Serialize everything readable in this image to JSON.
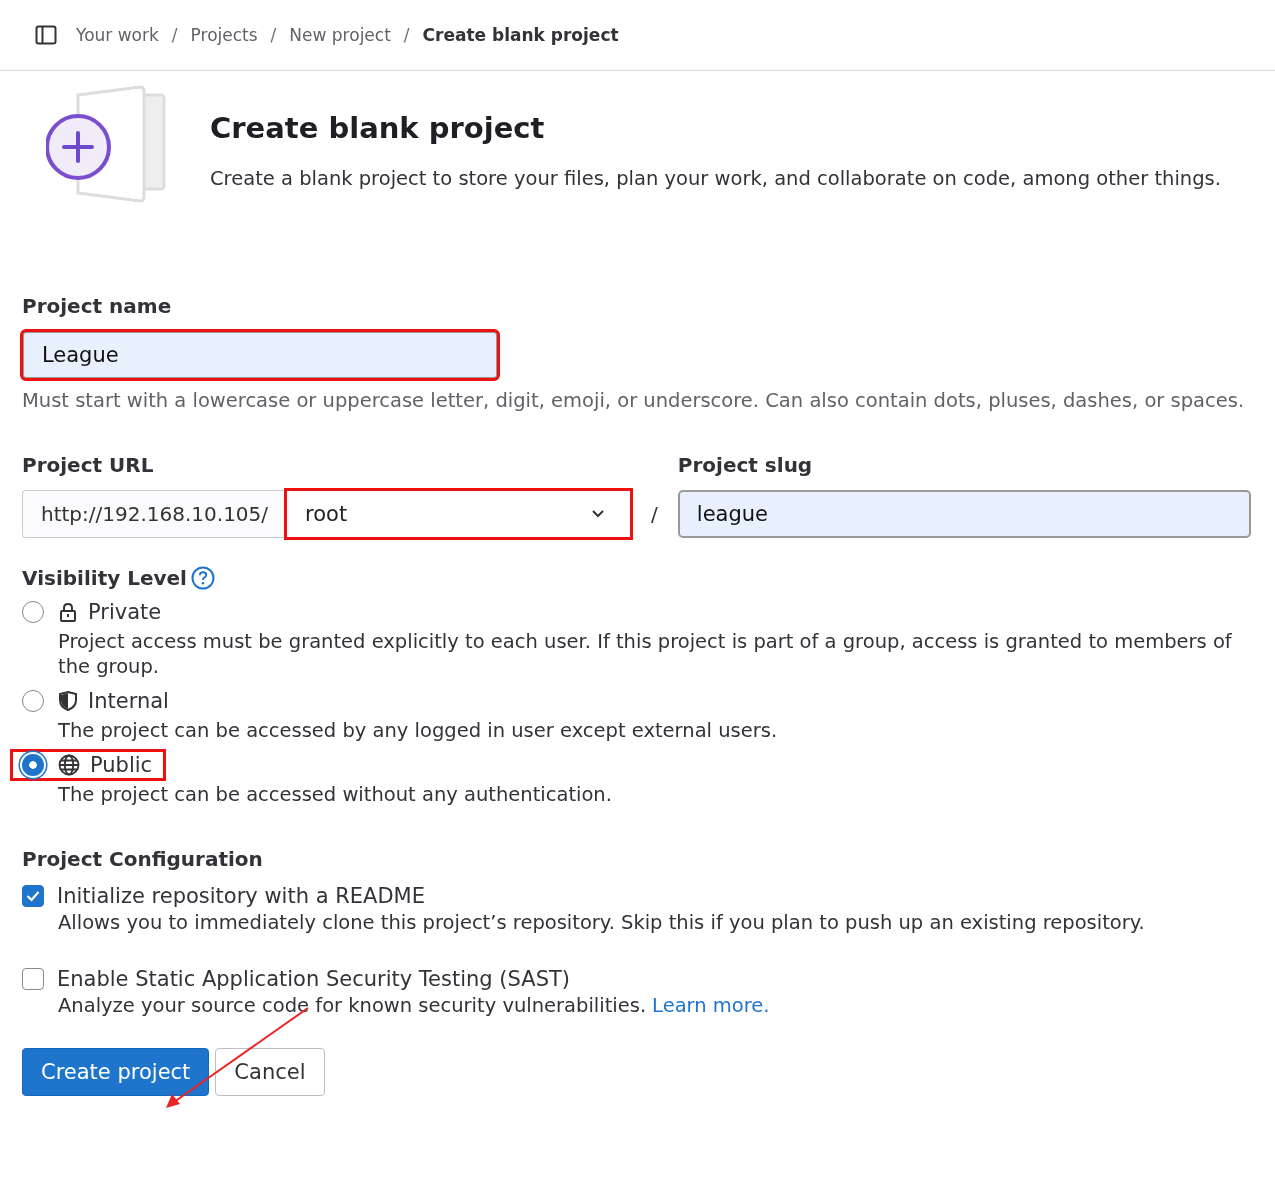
{
  "breadcrumb_separator": "/",
  "breadcrumbs": [
    {
      "label": "Your work",
      "current": false
    },
    {
      "label": "Projects",
      "current": false
    },
    {
      "label": "New project",
      "current": false
    },
    {
      "label": "Create blank project",
      "current": true
    }
  ],
  "header": {
    "title": "Create blank project",
    "description": "Create a blank project to store your files, plan your work, and collaborate on code, among other things."
  },
  "project_name": {
    "label": "Project name",
    "value": "League",
    "highlighted": true,
    "help": "Must start with a lowercase or uppercase letter, digit, emoji, or underscore. Can also contain dots, pluses, dashes, or spaces."
  },
  "project_url": {
    "label": "Project URL",
    "prefix": "http://192.168.10.105/",
    "namespace": "root",
    "highlighted": true,
    "separator": "/"
  },
  "project_slug": {
    "label": "Project slug",
    "value": "league"
  },
  "visibility": {
    "label": "Visibility Level",
    "options": [
      {
        "kind": "private",
        "label": "Private",
        "selected": false,
        "highlighted": false,
        "description": "Project access must be granted explicitly to each user. If this project is part of a group, access is granted to members of the group."
      },
      {
        "kind": "internal",
        "label": "Internal",
        "selected": false,
        "highlighted": false,
        "description": "The project can be accessed by any logged in user except external users."
      },
      {
        "kind": "public",
        "label": "Public",
        "selected": true,
        "highlighted": true,
        "description": "The project can be accessed without any authentication."
      }
    ]
  },
  "configuration": {
    "label": "Project Configuration",
    "options": [
      {
        "label": "Initialize repository with a README",
        "checked": true,
        "description": "Allows you to immediately clone this project’s repository. Skip this if you plan to push up an existing repository."
      },
      {
        "label": "Enable Static Application Security Testing (SAST)",
        "checked": false,
        "description": "Analyze your source code for known security vulnerabilities.",
        "link": "Learn more."
      }
    ]
  },
  "buttons": [
    {
      "kind": "primary",
      "label": "Create project"
    },
    {
      "kind": "secondary",
      "label": "Cancel"
    }
  ]
}
